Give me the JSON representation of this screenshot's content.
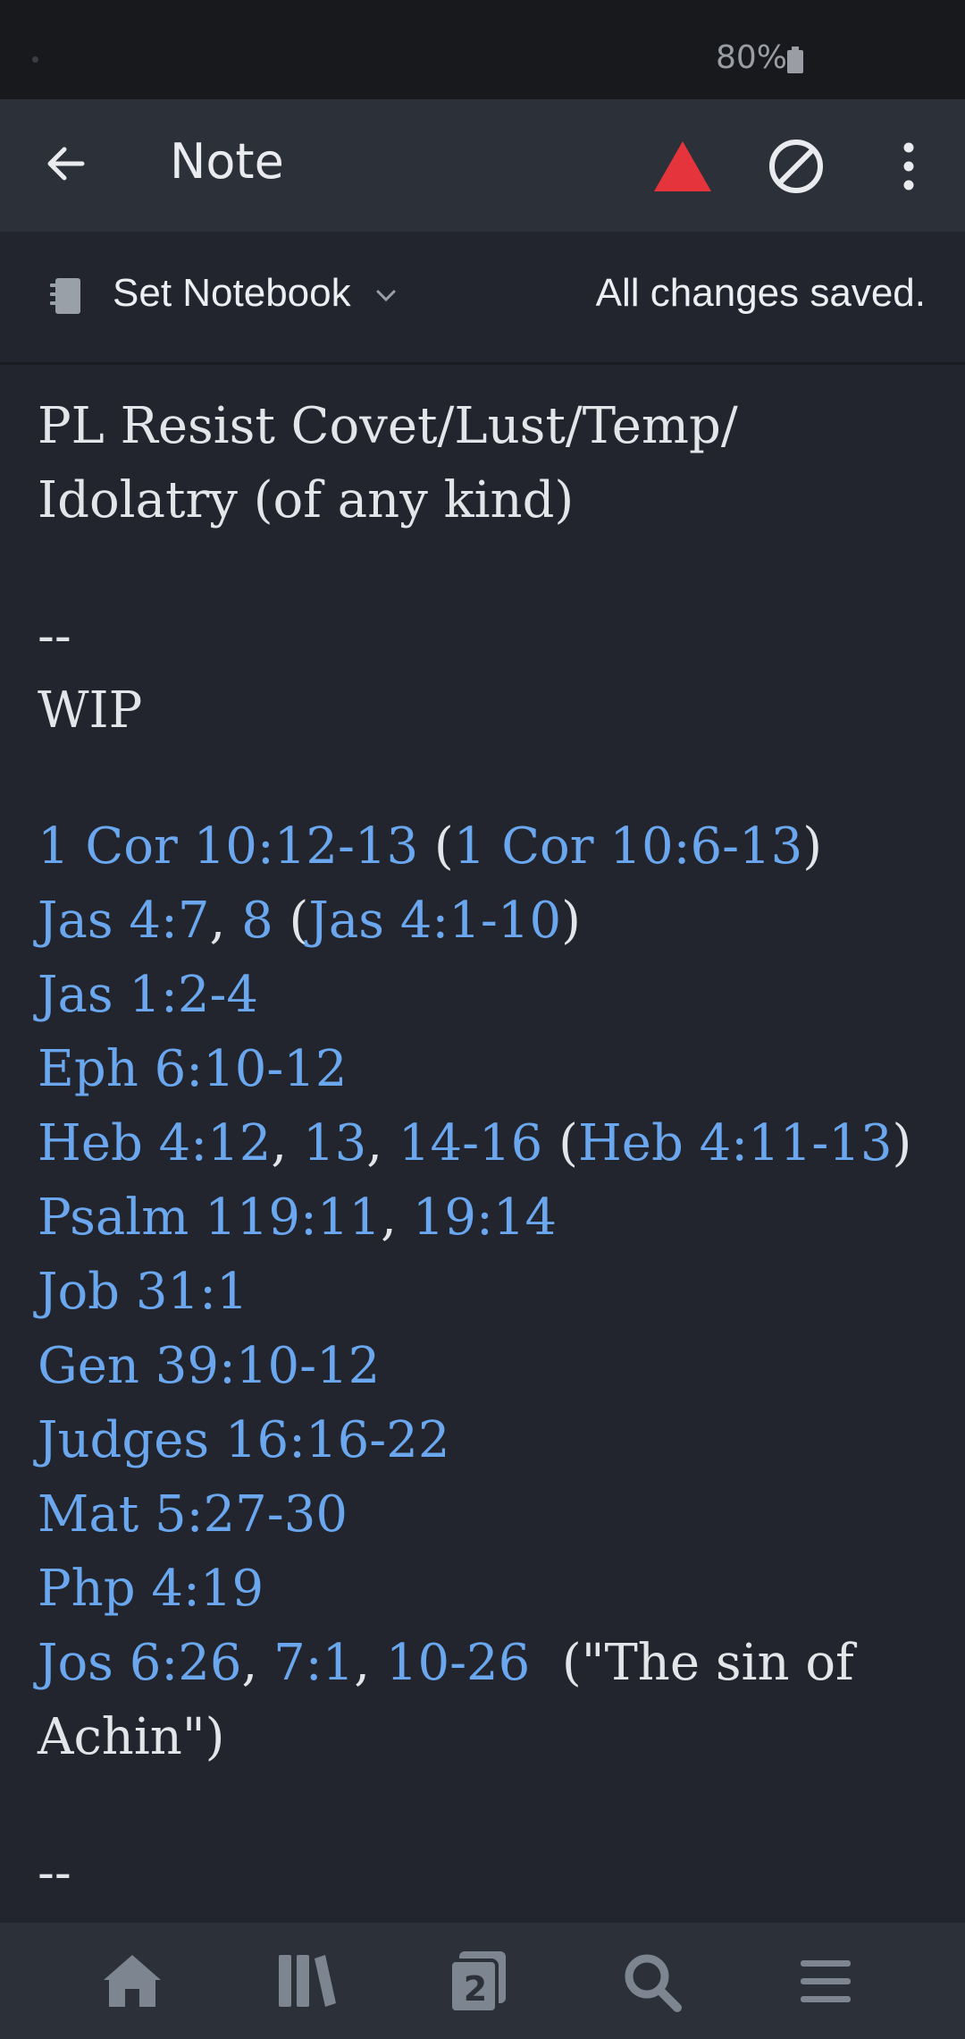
{
  "status_bar": {
    "battery": "80%"
  },
  "app_bar": {
    "title": "Note",
    "icons": [
      "back-icon",
      "warning-icon",
      "block-icon",
      "more-icon"
    ]
  },
  "notebook_bar": {
    "label": "Set Notebook",
    "status": "All changes saved."
  },
  "note": {
    "title_line1": "PL Resist Covet/Lust/Temp/",
    "title_line2": "Idolatry (of any kind)",
    "sep1": "--",
    "wip": "WIP",
    "refs": {
      "r1a": "1 Cor 10:12-13",
      "r1b": "1 Cor 10:6-13",
      "r2a": "Jas 4:7",
      "r2b": "8",
      "r2c": "Jas 4:1-10",
      "r3": "Jas 1:2-4",
      "r4": "Eph 6:10-12",
      "r5a": "Heb 4:12",
      "r5b": "13",
      "r5c": "14-16",
      "r5d": "Heb 4:11-13",
      "r6a": "Psalm 119:11",
      "r6b": "19:14",
      "r7": "Job 31:1",
      "r8": "Gen 39:10-12",
      "r9": "Judges 16:16-22",
      "r10": "Mat 5:27-30",
      "r11": "Php 4:19",
      "r12a": "Jos 6:26",
      "r12b": "7:1",
      "r12c": "10-26"
    },
    "achin_text1": "  (\"The sin of",
    "achin_text2": "Achin\")",
    "sep2": "--"
  },
  "bottom_nav": {
    "items": [
      "home-icon",
      "library-icon",
      "tabs-icon",
      "search-icon",
      "menu-icon"
    ],
    "tab_count": "2"
  },
  "colors": {
    "background": "#22252d",
    "bar": "#2c3038",
    "link": "#6aa7ef",
    "warning": "#e5343b"
  }
}
